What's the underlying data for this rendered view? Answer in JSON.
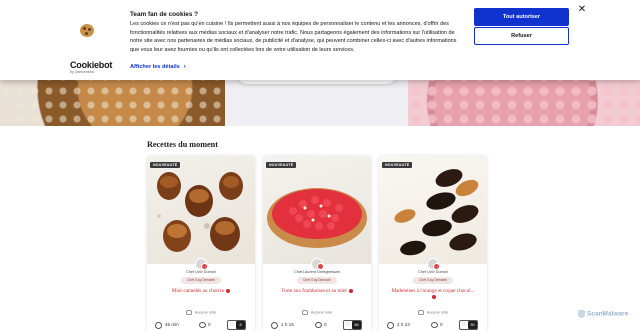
{
  "cookie_banner": {
    "title": "Team fan de cookies ?",
    "text": "Les cookies ce n'est pas qu'en cuisine ! Ils permettent aussi à nos équipes de personnaliser le contenu et les annonces, d'offrir des fonctionnalités relatives aux médias sociaux et d'analyser notre trafic. Nous partageons également des informations sur l'utilisation de notre site avec nos partenaires de médias sociaux, de publicité et d'analyse, qui peuvent combiner celles-ci avec d'autres informations que vous leur avez fournies ou qu'ils ont collectées lors de votre utilisation de leurs services.",
    "details_link": "Afficher les détails",
    "allow_button": "Tout autoriser",
    "refuse_button": "Refuser",
    "close_symbol": "✕",
    "brand_name": "Cookiebot",
    "brand_by": "by Usercentrics"
  },
  "section": {
    "title": "Recettes du moment"
  },
  "cards": [
    {
      "badge": "NOUVEAUTÉ",
      "chef": "Chef Ulric Durnez",
      "chef_badge": "Chef Guy Demarle",
      "title": "Mini-cannelés au chorizo",
      "rating": "Aucune note",
      "time": "45 min",
      "comments": "0",
      "favorites": "8"
    },
    {
      "badge": "NOUVEAUTÉ",
      "chef": "Chef Laurent Deregbessart",
      "chef_badge": "Chef Guy Demarle",
      "title": "Torte aux framboises et au miel",
      "rating": "Aucune note",
      "time": "1 h 15",
      "comments": "0",
      "favorites": "66"
    },
    {
      "badge": "NOUVEAUTÉ",
      "chef": "Chef Ulric Durnez",
      "chef_badge": "Chef Guy Demarle",
      "title": "Madeleines à l'orange et coque chocol...",
      "rating": "Aucune note",
      "time": "2 h 23",
      "comments": "0",
      "favorites": "30"
    }
  ],
  "watermark": "ScanMalware",
  "colors": {
    "accent": "#1032cf",
    "recipe_title": "#d0282b"
  }
}
